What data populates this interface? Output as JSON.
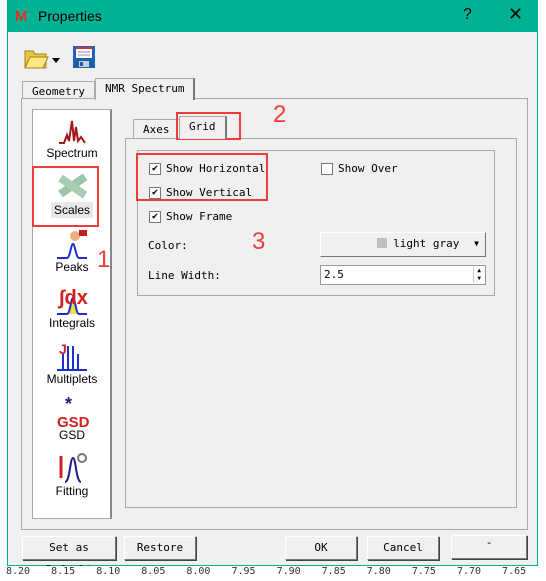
{
  "background": {
    "axis_ticks": [
      "8.20",
      "8.15",
      "8.10",
      "8.05",
      "8.00",
      "7.95",
      "7.90",
      "7.85",
      "7.80",
      "7.75",
      "7.70",
      "7.65"
    ]
  },
  "window": {
    "title": "Properties",
    "help": "?",
    "close": "✕"
  },
  "toolbar": {
    "open_icon": "folder-open-icon",
    "save_icon": "floppy-save-icon"
  },
  "tabs": [
    {
      "label": "Geometry"
    },
    {
      "label": "NMR Spectrum",
      "active": true
    }
  ],
  "sidebar": {
    "items": [
      {
        "label": "Spectrum"
      },
      {
        "label": "Scales",
        "selected": true
      },
      {
        "label": "Peaks"
      },
      {
        "label": "Integrals"
      },
      {
        "label": "Multiplets"
      },
      {
        "label": "GSD"
      },
      {
        "label": "Fitting"
      }
    ]
  },
  "inner_tabs": [
    {
      "label": "Axes"
    },
    {
      "label": "Grid",
      "active": true
    }
  ],
  "grid": {
    "show_horizontal": {
      "label": "Show Horizontal",
      "checked": true
    },
    "show_vertical": {
      "label": "Show Vertical",
      "checked": true
    },
    "show_frame": {
      "label": "Show Frame",
      "checked": true
    },
    "show_over": {
      "label": "Show Over",
      "checked": false
    },
    "color_label": "Color:",
    "color_value": "light gray",
    "color_swatch": "#c0c0c0",
    "line_width_label": "Line Width:",
    "line_width_value": "2.5"
  },
  "annotations": {
    "one": "1",
    "two": "2",
    "three": "3",
    "color": "#f03c3c"
  },
  "buttons": {
    "set_default": "Set as Default",
    "restore": "Restore",
    "ok": "OK",
    "cancel": "Cancel",
    "extra": "-"
  }
}
